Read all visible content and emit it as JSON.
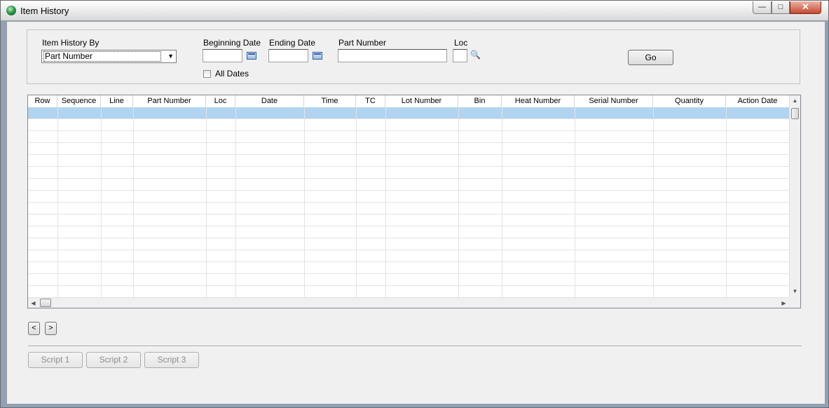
{
  "window": {
    "title": "Item History",
    "controls": {
      "minimize": "—",
      "maximize": "□",
      "close": "✕"
    }
  },
  "filters": {
    "history_by_label": "Item History By",
    "history_by_value": "Part Number",
    "beginning_date_label": "Beginning Date",
    "beginning_date_value": "",
    "ending_date_label": "Ending Date",
    "ending_date_value": "",
    "part_number_label": "Part Number",
    "part_number_value": "",
    "loc_label": "Loc",
    "loc_value": "",
    "all_dates_label": "All Dates",
    "all_dates_checked": false,
    "go_label": "Go"
  },
  "grid": {
    "columns": [
      "Row",
      "Sequence",
      "Line",
      "Part Number",
      "Loc",
      "Date",
      "Time",
      "TC",
      "Lot Number",
      "Bin",
      "Heat Number",
      "Serial Number",
      "Quantity",
      "Action Date"
    ],
    "rows": [],
    "selected_row": 0
  },
  "nav": {
    "prev": "<",
    "next": ">"
  },
  "scripts": [
    "Script 1",
    "Script 2",
    "Script 3"
  ],
  "icons": {
    "calendar": "calendar-icon",
    "lookup": "magnifier-icon",
    "app": "app-globe-icon"
  }
}
